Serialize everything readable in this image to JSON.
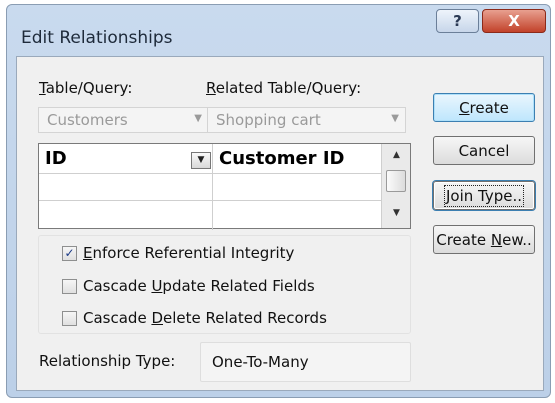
{
  "window": {
    "title": "Edit Relationships",
    "help_glyph": "?",
    "close_glyph": "X"
  },
  "table_query": {
    "label_prefix": "",
    "label_accel": "T",
    "label_rest": "able/Query:",
    "value": "Customers"
  },
  "related_table_query": {
    "label_prefix": "",
    "label_accel": "R",
    "label_rest": "elated Table/Query:",
    "value": "Shopping cart"
  },
  "field_grid": {
    "rows": [
      {
        "left": "ID",
        "right": "Customer ID"
      },
      {
        "left": "",
        "right": ""
      },
      {
        "left": "",
        "right": ""
      }
    ]
  },
  "options": {
    "enforce": {
      "prefix": "",
      "accel": "E",
      "rest": "nforce Referential Integrity",
      "checked": true
    },
    "cascade_update": {
      "prefix": "Cascade ",
      "accel": "U",
      "rest": "pdate Related Fields",
      "checked": false
    },
    "cascade_delete": {
      "prefix": "Cascade ",
      "accel": "D",
      "rest": "elete Related Records",
      "checked": false
    }
  },
  "relationship_type": {
    "label": "Relationship Type:",
    "value": "One-To-Many"
  },
  "buttons": {
    "create": {
      "prefix": "",
      "accel": "C",
      "rest": "reate"
    },
    "cancel": {
      "prefix": "Cancel",
      "accel": "",
      "rest": ""
    },
    "join_type": {
      "prefix": "",
      "accel": "J",
      "rest": "oin Type.."
    },
    "create_new": {
      "prefix": "Create ",
      "accel": "N",
      "rest": "ew.."
    }
  },
  "glyphs": {
    "check": "✓",
    "combo_arrow": "▼",
    "scroll_up": "▲",
    "scroll_down": "▼"
  }
}
